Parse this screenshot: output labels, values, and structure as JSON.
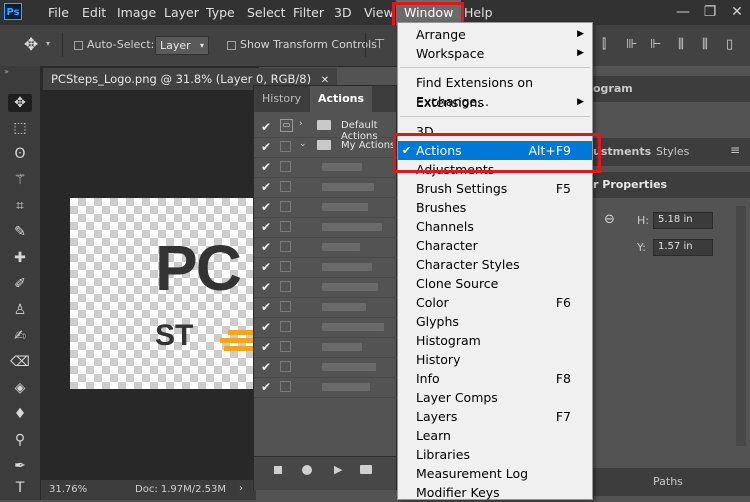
{
  "menubar": {
    "logo": "Ps",
    "items": [
      "File",
      "Edit",
      "Image",
      "Layer",
      "Type",
      "Select",
      "Filter",
      "3D",
      "View",
      "Window",
      "Help"
    ],
    "open_menu": "Window"
  },
  "window_controls": {
    "minimize": "—",
    "restore": "❐",
    "close": "✕"
  },
  "options": {
    "auto_select_label": "Auto-Select:",
    "layer_select_value": "Layer",
    "show_transform_label": "Show Transform Controls"
  },
  "document": {
    "tab_title": "PCSteps_Logo.png @ 31.8% (Layer 0, RGB/8)",
    "tab_close": "✕",
    "zoom": "31.76%",
    "doc_info": "Doc: 1.97M/2.53M",
    "logo_text_1": "PC",
    "logo_text_2": "ST"
  },
  "actions_panel": {
    "tabs": [
      "History",
      "Actions"
    ],
    "active_tab": "Actions",
    "sets": [
      "Default Actions",
      "My Actions"
    ],
    "row_check": "✔"
  },
  "right_dock": {
    "histogram_tab": "ogram",
    "adjustments_tab": "ustments",
    "styles_tab": "Styles",
    "properties_title": "r Properties",
    "h_label": "H:",
    "h_value": "5.18 in",
    "y_label": "Y:",
    "y_value": "1.57 in",
    "paths_tab": "Paths"
  },
  "window_menu": {
    "items": [
      {
        "label": "Arrange",
        "submenu": true
      },
      {
        "label": "Workspace",
        "submenu": true
      },
      {
        "label": "Find Extensions on Exchange..."
      },
      {
        "label": "Extensions",
        "submenu": true
      },
      {
        "label": "3D"
      },
      {
        "label": "Actions",
        "shortcut": "Alt+F9",
        "checked": true,
        "highlighted": true
      },
      {
        "label": "Adjustments"
      },
      {
        "label": "Brush Settings",
        "shortcut": "F5"
      },
      {
        "label": "Brushes"
      },
      {
        "label": "Channels"
      },
      {
        "label": "Character"
      },
      {
        "label": "Character Styles"
      },
      {
        "label": "Clone Source"
      },
      {
        "label": "Color",
        "shortcut": "F6"
      },
      {
        "label": "Glyphs"
      },
      {
        "label": "Histogram"
      },
      {
        "label": "History"
      },
      {
        "label": "Info",
        "shortcut": "F8"
      },
      {
        "label": "Layer Comps"
      },
      {
        "label": "Layers",
        "shortcut": "F7"
      },
      {
        "label": "Learn"
      },
      {
        "label": "Libraries"
      },
      {
        "label": "Measurement Log"
      },
      {
        "label": "Modifier Keys"
      }
    ]
  },
  "colors": {
    "highlight": "#0078d7",
    "annotation_red": "#e0181d",
    "accent_orange": "#f4a51c"
  }
}
